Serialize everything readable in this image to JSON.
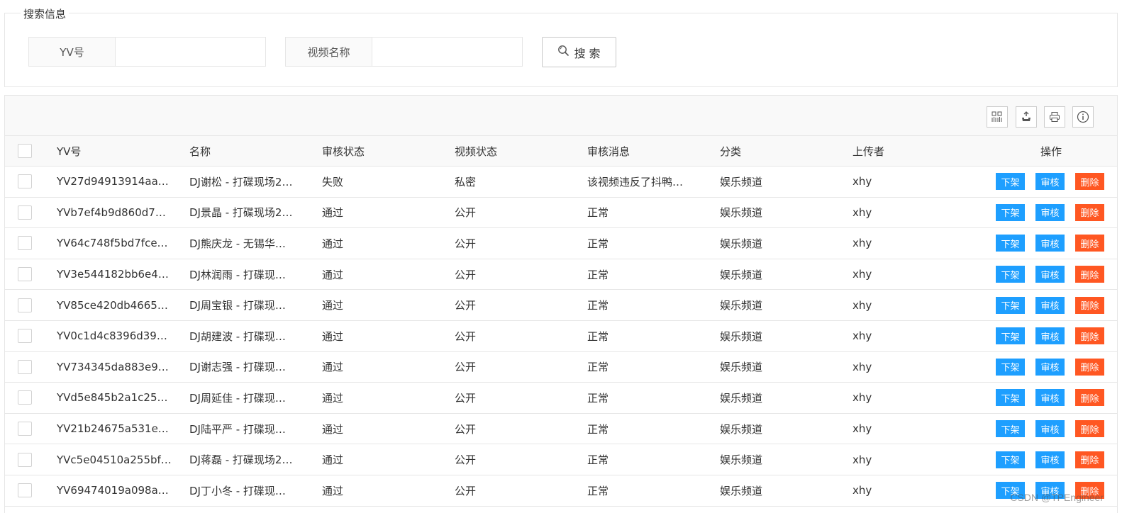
{
  "search": {
    "legend": "搜索信息",
    "yv_label": "YV号",
    "yv_value": "",
    "name_label": "视频名称",
    "name_value": "",
    "button_label": "搜 索"
  },
  "toolbar": {
    "icons": [
      "columns-icon",
      "export-icon",
      "print-icon",
      "info-icon"
    ]
  },
  "table": {
    "headers": {
      "yv": "YV号",
      "name": "名称",
      "audit": "审核状态",
      "vstate": "视频状态",
      "msg": "审核消息",
      "cat": "分类",
      "uploader": "上传者",
      "ops": "操作"
    },
    "rows": [
      {
        "yv": "YV27d94913914aa…",
        "name": "DJ谢松 - 打碟现场2…",
        "audit": "失败",
        "vstate": "私密",
        "msg": "该视频违反了抖鸭…",
        "cat": "娱乐频道",
        "uploader": "xhy"
      },
      {
        "yv": "YVb7ef4b9d860d7…",
        "name": "DJ景晶 - 打碟现场2…",
        "audit": "通过",
        "vstate": "公开",
        "msg": "正常",
        "cat": "娱乐频道",
        "uploader": "xhy"
      },
      {
        "yv": "YV64c748f5bd7fce…",
        "name": "DJ熊庆龙 - 无锡华…",
        "audit": "通过",
        "vstate": "公开",
        "msg": "正常",
        "cat": "娱乐频道",
        "uploader": "xhy"
      },
      {
        "yv": "YV3e544182bb6e4…",
        "name": "DJ林润雨 - 打碟现…",
        "audit": "通过",
        "vstate": "公开",
        "msg": "正常",
        "cat": "娱乐频道",
        "uploader": "xhy"
      },
      {
        "yv": "YV85ce420db4665…",
        "name": "DJ周宝银 - 打碟现…",
        "audit": "通过",
        "vstate": "公开",
        "msg": "正常",
        "cat": "娱乐频道",
        "uploader": "xhy"
      },
      {
        "yv": "YV0c1d4c8396d39…",
        "name": "DJ胡建波 - 打碟现…",
        "audit": "通过",
        "vstate": "公开",
        "msg": "正常",
        "cat": "娱乐频道",
        "uploader": "xhy"
      },
      {
        "yv": "YV734345da883e9…",
        "name": "DJ谢志强 - 打碟现…",
        "audit": "通过",
        "vstate": "公开",
        "msg": "正常",
        "cat": "娱乐频道",
        "uploader": "xhy"
      },
      {
        "yv": "YVd5e845b2a1c25…",
        "name": "DJ周延佳 - 打碟现…",
        "audit": "通过",
        "vstate": "公开",
        "msg": "正常",
        "cat": "娱乐频道",
        "uploader": "xhy"
      },
      {
        "yv": "YV21b24675a531e…",
        "name": "DJ陆平严 - 打碟现…",
        "audit": "通过",
        "vstate": "公开",
        "msg": "正常",
        "cat": "娱乐频道",
        "uploader": "xhy"
      },
      {
        "yv": "YVc5e04510a255bf…",
        "name": "DJ蒋磊 - 打碟现场2…",
        "audit": "通过",
        "vstate": "公开",
        "msg": "正常",
        "cat": "娱乐频道",
        "uploader": "xhy"
      },
      {
        "yv": "YV69474019a098a…",
        "name": "DJ丁小冬 - 打碟现…",
        "audit": "通过",
        "vstate": "公开",
        "msg": "正常",
        "cat": "娱乐频道",
        "uploader": "xhy"
      }
    ],
    "actions": {
      "takedown": "下架",
      "review": "审核",
      "delete": "删除"
    }
  },
  "colors": {
    "primary": "#1e9fff",
    "danger": "#ff5722",
    "border": "#e6e6e6",
    "header_bg": "#f9f9f9"
  },
  "watermark": "CSDN @TPEngineer"
}
